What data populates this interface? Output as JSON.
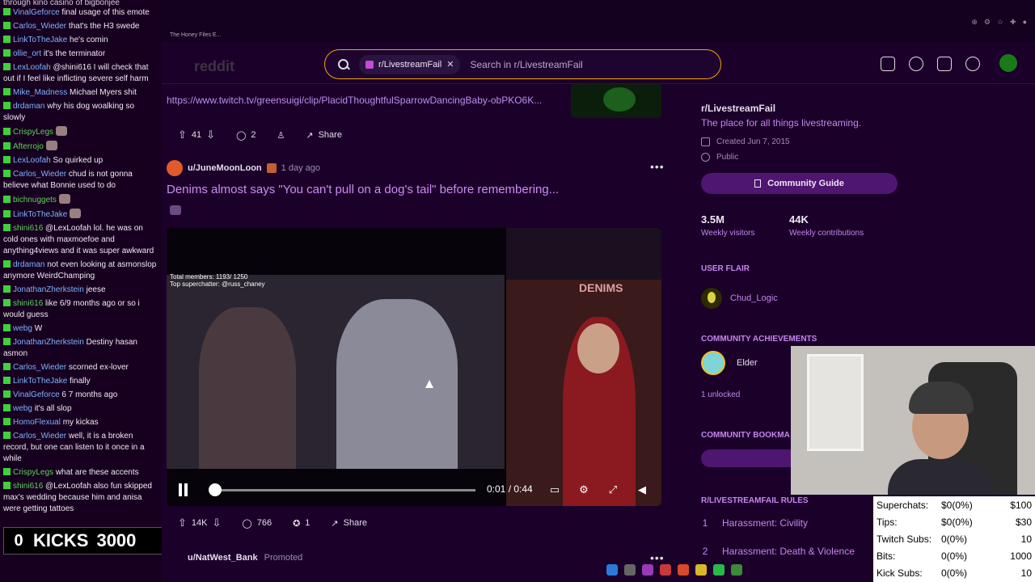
{
  "chat": {
    "top_line": "through kino casino of bigbonjee",
    "messages": [
      {
        "user": "VinalGeforce",
        "text": "final usage of this emote",
        "color": "blue"
      },
      {
        "user": "Carlos_Wieder",
        "text": "that's the H3 swede",
        "color": "blue"
      },
      {
        "user": "LinkToTheJake",
        "text": "he's comin",
        "color": "blue"
      },
      {
        "user": "ollie_ort",
        "text": "it's the terminator",
        "color": "blue"
      },
      {
        "user": "LexLoofah",
        "text": "@shini616 I will check that out if I feel like inflicting severe self harm",
        "color": "blue"
      },
      {
        "user": "Mike_Madness",
        "text": "Michael Myers shit",
        "color": "blue"
      },
      {
        "user": "drdaman",
        "text": "why his dog woalking so slowly",
        "color": "blue"
      },
      {
        "user": "CrispyLegs",
        "text": "",
        "color": "green",
        "emote": true
      },
      {
        "user": "Afterrojo",
        "text": "",
        "color": "green",
        "emote": true
      },
      {
        "user": "LexLoofah",
        "text": "So quirked up",
        "color": "blue"
      },
      {
        "user": "Carlos_Wieder",
        "text": "chud is not gonna believe what Bonnie used to do",
        "color": "blue"
      },
      {
        "user": "bichnuggets",
        "text": "",
        "color": "green",
        "emote": true
      },
      {
        "user": "LinkToTheJake",
        "text": "",
        "color": "blue",
        "emote": true
      },
      {
        "user": "shini616",
        "text": "@LexLoofah lol. he was on cold ones with maxmoefoe and anything4views and it was super awkward",
        "color": "green"
      },
      {
        "user": "drdaman",
        "text": "not even looking at asmonslop anymore WeirdChamping",
        "color": "blue"
      },
      {
        "user": "JonathanZherkstein",
        "text": "jeese",
        "color": "blue"
      },
      {
        "user": "shini616",
        "text": "like 6/9 months ago or so i would guess",
        "color": "green"
      },
      {
        "user": "webg",
        "text": "W",
        "color": "blue"
      },
      {
        "user": "JonathanZherkstein",
        "text": "Destiny hasan asmon",
        "color": "blue"
      },
      {
        "user": "Carlos_Wieder",
        "text": "scorned ex-lover",
        "color": "blue"
      },
      {
        "user": "LinkToTheJake",
        "text": "finally",
        "color": "blue"
      },
      {
        "user": "VinalGeforce",
        "text": "6 7 months ago",
        "color": "blue"
      },
      {
        "user": "webg",
        "text": "it's all slop",
        "color": "blue"
      },
      {
        "user": "HomoFlexual",
        "text": "my kickas",
        "color": "blue"
      },
      {
        "user": "Carlos_Wieder",
        "text": "well, it is a broken record, but one can listen to it once in a while",
        "color": "blue"
      },
      {
        "user": "CrispyLegs",
        "text": "what are these accents",
        "color": "green"
      },
      {
        "user": "shini616",
        "text": "@LexLoofah also fun skipped max's wedding because him and anisa were getting tattoes",
        "color": "green"
      }
    ],
    "kicks": {
      "count": "0",
      "label": "KICKS",
      "goal": "3000"
    }
  },
  "browser": {
    "tab_title": "The Honey Files E...",
    "logo": "reddit",
    "search": {
      "chip": "r/LivestreamFail",
      "placeholder": "Search in r/LivestreamFail"
    }
  },
  "feed": {
    "clip_link": "https://www.twitch.tv/greensuigi/clip/PlacidThoughtfulSparrowDancingBaby-obPKO6K...",
    "prev_actions": {
      "votes": "41",
      "comments": "2",
      "share": "Share"
    },
    "post": {
      "user": "u/JuneMoonLoon",
      "ago": "1 day ago",
      "title": "Denims almost says \"You can't pull on a dog's tail\" before remembering...",
      "video_overlay_1": "Total members: 1193/ 1250",
      "video_overlay_2": "Top superchatter: @russ_chaney",
      "video_sign": "DENIMS",
      "time": "0:01 / 0:44",
      "votes": "14K",
      "comments": "766",
      "awards": "1",
      "share": "Share"
    },
    "promo": {
      "user": "u/NatWest_Bank",
      "label": "Promoted"
    }
  },
  "sidebar": {
    "name": "r/LivestreamFail",
    "desc": "The place for all things livestreaming.",
    "created": "Created Jun 7, 2015",
    "visibility": "Public",
    "guide_btn": "Community Guide",
    "stats": [
      {
        "value": "3.5M",
        "label": "Weekly visitors"
      },
      {
        "value": "44K",
        "label": "Weekly contributions"
      }
    ],
    "user_flair_heading": "USER FLAIR",
    "flair": "Chud_Logic",
    "ach_heading": "COMMUNITY ACHIEVEMENTS",
    "ach_name": "Elder",
    "unlocked": "1 unlocked",
    "bookmarks_heading": "COMMUNITY BOOKMA",
    "rules_heading": "R/LIVESTREAMFAIL RULES",
    "rules": [
      {
        "n": "1",
        "text": "Harassment: Civility"
      },
      {
        "n": "2",
        "text": "Harassment: Death & Violence"
      }
    ]
  },
  "donations": [
    {
      "label": "Superchats:",
      "value": "$0(0%)",
      "goal": "$100"
    },
    {
      "label": "Tips:",
      "value": "$0(0%)",
      "goal": "$30"
    },
    {
      "label": "Twitch Subs:",
      "value": "0(0%)",
      "goal": "10"
    },
    {
      "label": "Bits:",
      "value": "0(0%)",
      "goal": "1000"
    },
    {
      "label": "Kick Subs:",
      "value": "0(0%)",
      "goal": "10"
    }
  ],
  "colors": {
    "accent": "#c685f0",
    "search_border": "#f0a316",
    "bg": "#1b0029"
  }
}
